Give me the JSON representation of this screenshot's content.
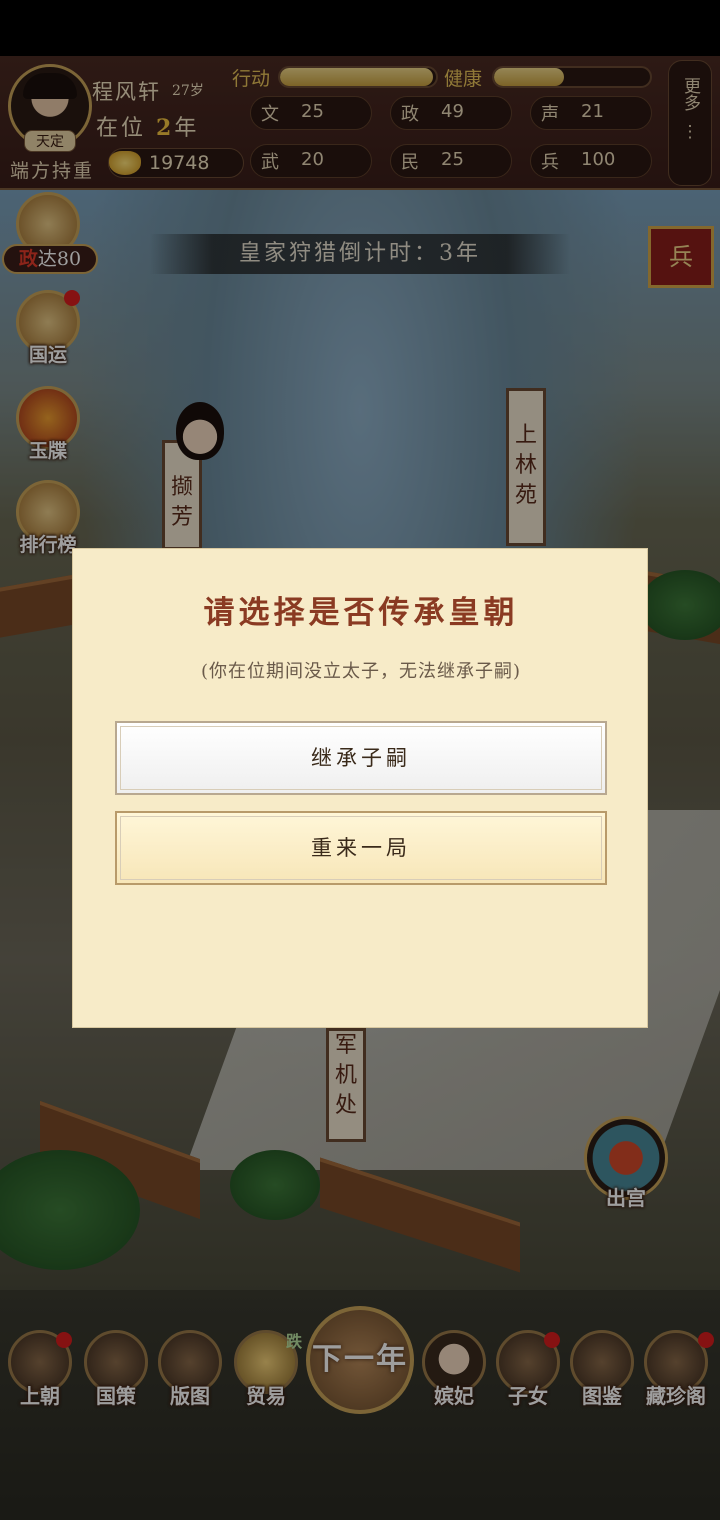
{
  "hud": {
    "era_title": "天定",
    "emperor_name": "程风轩",
    "age": "27岁",
    "reign_prefix": "在位",
    "reign_years": "2",
    "reign_suffix": "年",
    "honor_title": "端方持重",
    "gold": "19748",
    "action_label": "行动",
    "action_level": 0.98,
    "health_label": "健康",
    "health_level": 0.45,
    "stats": [
      {
        "key": "文",
        "value": "25"
      },
      {
        "key": "政",
        "value": "49"
      },
      {
        "key": "声",
        "value": "21"
      },
      {
        "key": "武",
        "value": "20"
      },
      {
        "key": "民",
        "value": "25"
      },
      {
        "key": "兵",
        "value": "100"
      }
    ],
    "more_label": "更多"
  },
  "scene": {
    "timer_text": "皇家狩猎倒计时：3年",
    "zhengda_prefix": "政",
    "zhengda_rest": "达80",
    "side_buttons": [
      {
        "label": "国运",
        "badge": true
      },
      {
        "label": "玉牒",
        "badge": false
      },
      {
        "label": "排行榜",
        "badge": false
      }
    ],
    "bing_label": "兵",
    "banners": {
      "shanglin": "上林苑",
      "xiefang": "撷芳",
      "junji": "军机处"
    },
    "exit_palace_label": "出宫"
  },
  "modal": {
    "title": "请选择是否传承皇朝",
    "subtitle": "(你在位期间没立太子，无法继承子嗣)",
    "option_inherit": "继承子嗣",
    "option_restart": "重来一局"
  },
  "bottom_nav": {
    "items": [
      {
        "label": "上朝",
        "badge": true
      },
      {
        "label": "国策",
        "badge": false
      },
      {
        "label": "版图",
        "badge": false
      },
      {
        "label": "贸易",
        "tag": "跌"
      },
      {
        "label": "嫔妃",
        "badge": false
      },
      {
        "label": "子女",
        "badge": true
      },
      {
        "label": "图鉴",
        "badge": false
      },
      {
        "label": "藏珍阁",
        "badge": true
      }
    ],
    "next_year_label": "下一年"
  }
}
